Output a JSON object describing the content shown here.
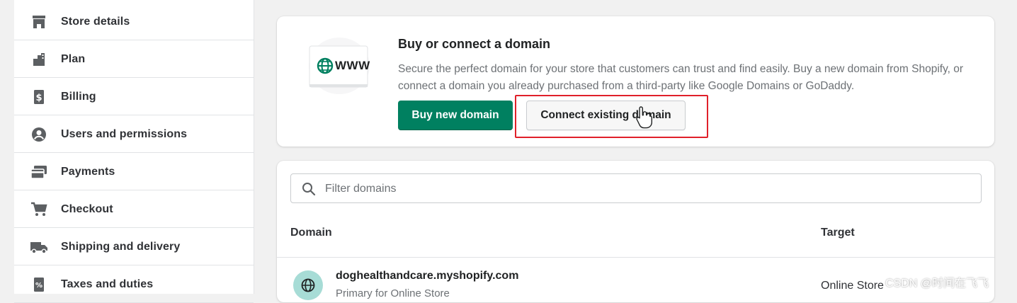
{
  "sidebar": {
    "items": [
      {
        "label": "Store details",
        "icon": "store-icon"
      },
      {
        "label": "Plan",
        "icon": "plan-icon"
      },
      {
        "label": "Billing",
        "icon": "billing-icon"
      },
      {
        "label": "Users and permissions",
        "icon": "user-icon"
      },
      {
        "label": "Payments",
        "icon": "payments-icon"
      },
      {
        "label": "Checkout",
        "icon": "cart-icon"
      },
      {
        "label": "Shipping and delivery",
        "icon": "truck-icon"
      },
      {
        "label": "Taxes and duties",
        "icon": "tax-icon"
      }
    ]
  },
  "domain_card": {
    "illustration_text": "www",
    "title": "Buy or connect a domain",
    "description": "Secure the perfect domain for your store that customers can trust and find easily. Buy a new domain from Shopify, or connect a domain you already purchased from a third-party like Google Domains or GoDaddy.",
    "buy_button": "Buy new domain",
    "connect_button": "Connect existing domain"
  },
  "domains_list": {
    "filter_placeholder": "Filter domains",
    "columns": {
      "domain": "Domain",
      "target": "Target"
    },
    "rows": [
      {
        "domain": "doghealthandcare.myshopify.com",
        "subtitle": "Primary for Online Store",
        "target": "Online Store"
      }
    ]
  },
  "watermark": "CSDN @时间在飞飞",
  "colors": {
    "primary": "#008060",
    "highlight": "#e0202a",
    "globe_bg": "#a7dcd6"
  }
}
